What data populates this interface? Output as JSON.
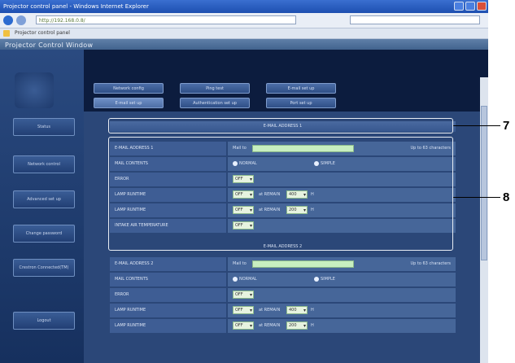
{
  "browser": {
    "title": "Projector control panel - Windows Internet Explorer",
    "address": "http://192.168.0.8/",
    "favorite": "Projector control panel"
  },
  "app": {
    "title": "Projector Control Window"
  },
  "sidebar": [
    "Status",
    "Network control",
    "Advanced set up",
    "Change password",
    "Crestron Connected(TM)",
    "Logout"
  ],
  "tabs": {
    "row1": [
      "Network config",
      "Ping test",
      "E-mail set up"
    ],
    "row2": [
      "E-mail set up",
      "Authentication set up",
      "Port set up"
    ]
  },
  "section1": {
    "header": "E-MAIL ADDRESS 1",
    "rows": {
      "address_label": "E-MAIL ADDRESS 1",
      "address_prefix": "Mail to",
      "address_note": "Up to 63 characters",
      "condition_label": "MAIL CONTENTS",
      "normal": "NORMAL",
      "simple": "SIMPLE",
      "error_label": "ERROR",
      "lamp1_label": "LAMP RUNTIME",
      "lamp2_label": "LAMP RUNTIME",
      "intake_label": "INTAKE AIR TEMPERATURE",
      "at_remain": "at REMAIN",
      "hours": "H",
      "on": "OFF",
      "hours_val_1": "400",
      "hours_val_2": "200"
    }
  },
  "section2": {
    "header": "E-MAIL ADDRESS 2",
    "rows": {
      "address_label": "E-MAIL ADDRESS 2",
      "address_prefix": "Mail to",
      "address_note": "Up to 63 characters",
      "condition_label": "MAIL CONTENTS",
      "normal": "NORMAL",
      "simple": "SIMPLE",
      "error_label": "ERROR",
      "lamp1_label": "LAMP RUNTIME",
      "lamp2_label": "LAMP RUNTIME",
      "at_remain": "at REMAIN",
      "hours": "H",
      "on": "OFF",
      "hours_val_1": "400",
      "hours_val_2": "200"
    }
  },
  "callouts": {
    "seven": "7",
    "eight": "8"
  }
}
